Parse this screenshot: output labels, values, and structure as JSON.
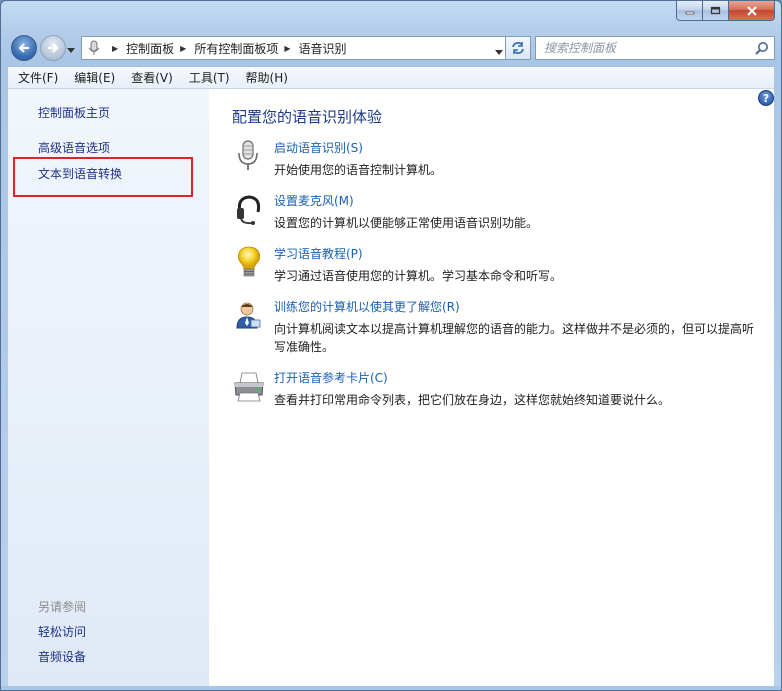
{
  "window": {
    "caption_icons": [
      "minimize-icon",
      "maximize-icon",
      "close-icon"
    ]
  },
  "address_bar": {
    "breadcrumbs": [
      "控制面板",
      "所有控制面板项",
      "语音识别"
    ]
  },
  "search": {
    "placeholder": "搜索控制面板"
  },
  "menu": [
    {
      "label": "文件(F)"
    },
    {
      "label": "编辑(E)"
    },
    {
      "label": "查看(V)"
    },
    {
      "label": "工具(T)"
    },
    {
      "label": "帮助(H)"
    }
  ],
  "sidebar": {
    "home": "控制面板主页",
    "links": [
      "高级语音选项",
      "文本到语音转换"
    ],
    "see_also_title": "另请参阅",
    "see_also": [
      "轻松访问",
      "音频设备"
    ]
  },
  "main": {
    "title": "配置您的语音识别体验",
    "tasks": [
      {
        "icon": "microphone-icon",
        "link": "启动语音识别(S)",
        "desc": "开始使用您的语音控制计算机。"
      },
      {
        "icon": "headset-icon",
        "link": "设置麦克风(M)",
        "desc": "设置您的计算机以便能够正常使用语音识别功能。"
      },
      {
        "icon": "lightbulb-icon",
        "link": "学习语音教程(P)",
        "desc": "学习通过语音使用您的计算机。学习基本命令和听写。"
      },
      {
        "icon": "user-train-icon",
        "link": "训练您的计算机以使其更了解您(R)",
        "desc": "向计算机阅读文本以提高计算机理解您的语音的能力。这样做并不是必须的，但可以提高听写准确性。"
      },
      {
        "icon": "printer-icon",
        "link": "打开语音参考卡片(C)",
        "desc": "查看并打印常用命令列表，把它们放在身边，这样您就始终知道要说什么。"
      }
    ]
  },
  "colors": {
    "link": "#1a5fb4",
    "title": "#1e3a8a",
    "highlight_border": "#e02424"
  }
}
